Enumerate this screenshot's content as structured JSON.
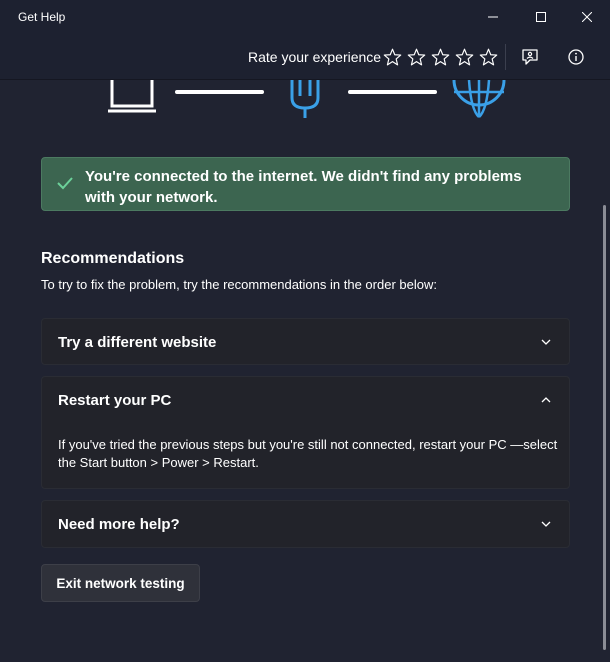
{
  "window": {
    "title": "Get Help",
    "controls": [
      "minimize-icon",
      "maximize-icon",
      "close-icon"
    ]
  },
  "header": {
    "rate_label": "Rate your experience",
    "stars": [
      {
        "icon": "star-outline-icon"
      },
      {
        "icon": "star-outline-icon"
      },
      {
        "icon": "star-outline-icon"
      },
      {
        "icon": "star-outline-icon"
      },
      {
        "icon": "star-outline-icon"
      }
    ],
    "rating": 0,
    "actions": [
      "feedback-icon",
      "info-icon"
    ]
  },
  "network_diagram": {
    "nodes": [
      "laptop-icon",
      "router-icon",
      "globe-icon"
    ],
    "router_color": "#3aa0e8",
    "globe_color": "#3aa0e8"
  },
  "status": {
    "icon": "checkmark-icon",
    "message": "You're connected to the internet. We didn't find any problems with your network.",
    "background_color": "#3c6550",
    "icon_color": "#6cd19a"
  },
  "recommendations": {
    "title": "Recommendations",
    "description": "To try to fix the problem, try the recommendations in the order below:",
    "items": [
      {
        "title": "Try a different website",
        "expanded": false,
        "icon": "chevron-down-icon"
      },
      {
        "title": "Restart your PC",
        "expanded": true,
        "icon": "chevron-up-icon",
        "body": "If you've tried the previous steps but you're still not connected, restart your PC —select the Start button > Power > Restart."
      },
      {
        "title": "Need more help?",
        "expanded": false,
        "icon": "chevron-down-icon"
      }
    ]
  },
  "actions": {
    "exit_label": "Exit network testing"
  }
}
